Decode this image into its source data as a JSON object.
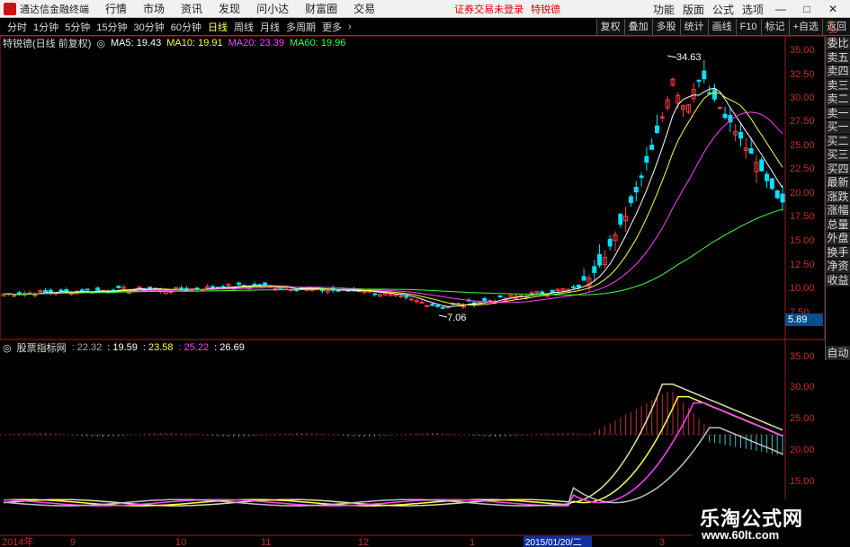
{
  "titlebar": {
    "app_name": "通达信金融终端",
    "menus": [
      "行情",
      "市场",
      "资讯",
      "发现",
      "问小达",
      "财富圈",
      "交易"
    ],
    "notice": "证券交易未登录",
    "stock": "特锐德",
    "right_items": [
      "功能",
      "版面",
      "公式",
      "选项"
    ]
  },
  "toolbar": {
    "periods": [
      "分时",
      "1分钟",
      "5分钟",
      "15分钟",
      "30分钟",
      "60分钟",
      "日线",
      "周线",
      "月线",
      "多周期",
      "更多"
    ],
    "active_period": "日线",
    "right_buttons": [
      "复权",
      "叠加",
      "多股",
      "统计",
      "画线",
      "F10",
      "标记",
      "+自选",
      "返回"
    ]
  },
  "corner_badges": [
    "R",
    "S0"
  ],
  "main_legend": {
    "title": "特锐德(日线 前复权)",
    "ma5": "MA5: 19.43",
    "ma10": "MA10: 19.91",
    "ma20": "MA20: 23.39",
    "ma60": "MA60: 19.96"
  },
  "sub_legend": {
    "title": "股票指标网",
    "v1": ": 22.32",
    "v2": ": 19.59",
    "v3": ": 23.58",
    "v4": ": 25.22",
    "v5": ": 26.69"
  },
  "sidebar_items": [
    "委比",
    "卖五",
    "卖四",
    "卖三",
    "卖二",
    "卖一",
    "买一",
    "买二",
    "买三",
    "买四",
    "最新",
    "涨跌",
    "涨幅",
    "总量",
    "外盘",
    "换手",
    "净资",
    "收益"
  ],
  "auto_label": "自动",
  "price_tag": "5.89",
  "main_axis_labels": [
    "35.00",
    "32.50",
    "30.00",
    "27.50",
    "25.00",
    "22.50",
    "20.00",
    "17.50",
    "15.00",
    "12.50",
    "10.00",
    "7.50"
  ],
  "sub_axis_labels": [
    "35.00",
    "30.00",
    "25.00",
    "20.00",
    "15.00"
  ],
  "peak_label": "34.63",
  "low_label": "7.06",
  "x_axis_labels": [
    "2014年",
    "9",
    "10",
    "11",
    "12",
    "1",
    "2015/01/20/二",
    "3"
  ],
  "watermark": {
    "title": "乐淘公式网",
    "url": "www.60lt.com"
  },
  "colors": {
    "up": "#ff4040",
    "down": "#00e0ff",
    "ma5": "#ffffff",
    "ma10": "#ffff40",
    "ma20": "#ff40ff",
    "ma60": "#40ff40",
    "axis": "#c03030"
  }
}
